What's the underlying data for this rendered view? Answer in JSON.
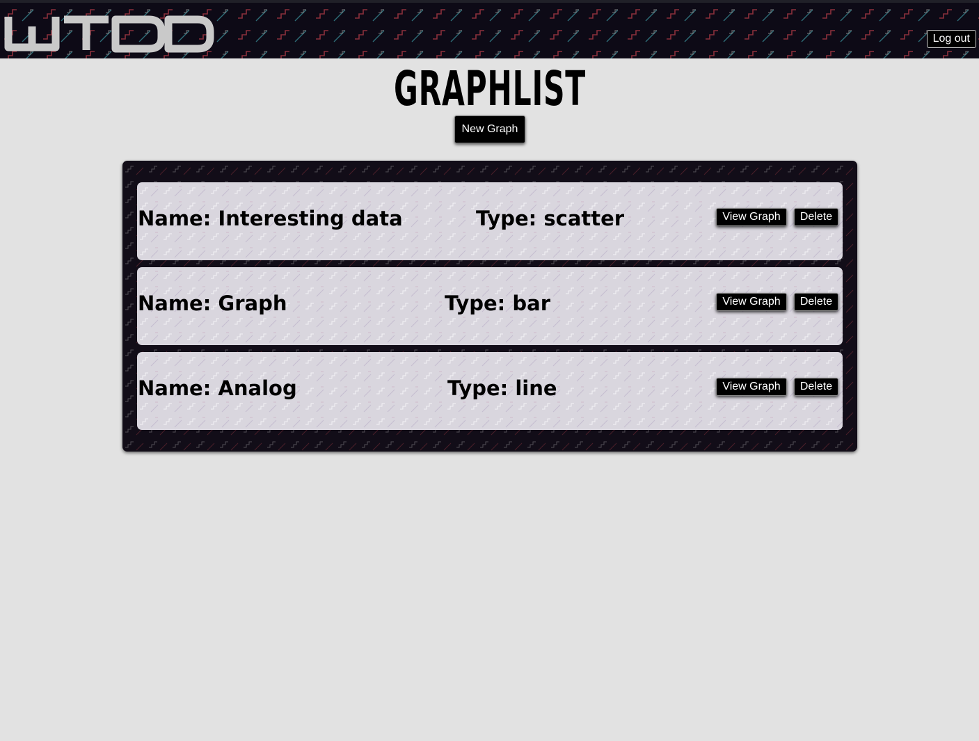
{
  "header": {
    "logo_text": "WTDD",
    "logout_label": "Log out"
  },
  "page": {
    "title": "GRAPHLIST",
    "new_graph_label": "New Graph"
  },
  "graphs": [
    {
      "name": "Name: Interesting data",
      "type": "Type: scatter",
      "view_label": "View Graph",
      "delete_label": "Delete"
    },
    {
      "name": "Name: Graph",
      "type": "Type: bar",
      "view_label": "View Graph",
      "delete_label": "Delete"
    },
    {
      "name": "Name: Analog",
      "type": "Type: line",
      "view_label": "View Graph",
      "delete_label": "Delete"
    }
  ],
  "colors": {
    "page_background": "#e2e2e2",
    "header_background": "#0d0a16",
    "panel_background": "#120d18",
    "row_background": "#d9d6de",
    "button_background": "#000000",
    "pattern_red": "#b43c46",
    "pattern_teal": "#3c96a0",
    "pattern_grey": "#8c8c8c"
  }
}
